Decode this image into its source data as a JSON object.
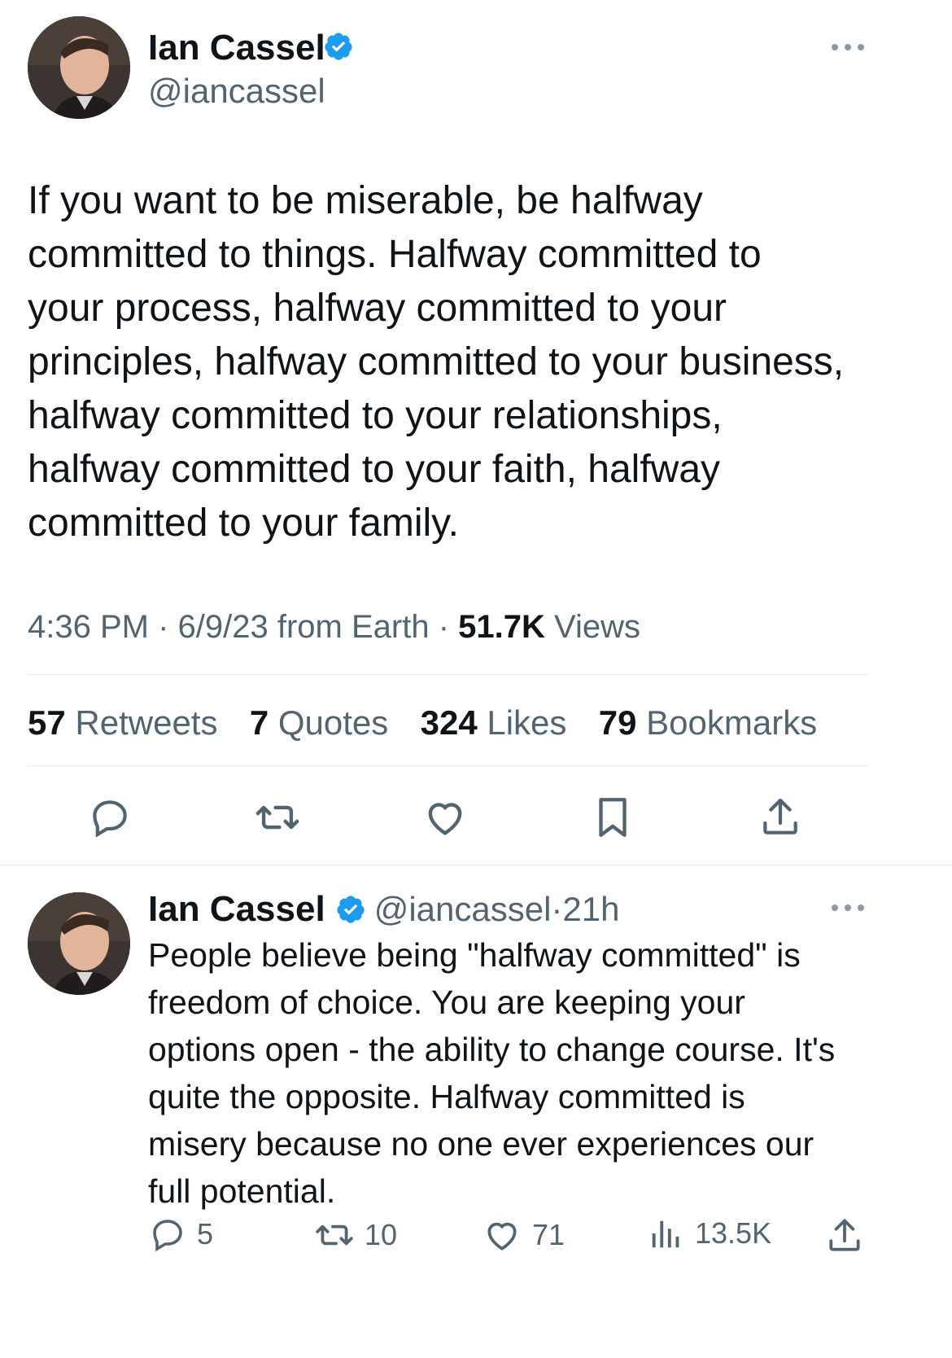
{
  "main_tweet": {
    "author_name": "Ian Cassel",
    "author_handle": "@iancassel",
    "more_icon": "more-icon",
    "text_lines": [
      "If you want to be miserable, be halfway",
      "committed to things. Halfway committed to",
      "your process, halfway committed to your",
      "principles, halfway committed to your business,",
      "halfway committed to your relationships,",
      "halfway committed to your faith, halfway",
      "committed to your family."
    ],
    "time": "4:36 PM",
    "date": "6/9/23 from Earth",
    "views_count": "51.7K",
    "views_label": "Views",
    "stats": {
      "retweets_count": "57",
      "retweets_label": "Retweets",
      "quotes_count": "7",
      "quotes_label": "Quotes",
      "likes_count": "324",
      "likes_label": "Likes",
      "bookmarks_count": "79",
      "bookmarks_label": "Bookmarks"
    },
    "actions": [
      "reply-icon",
      "retweet-icon",
      "like-icon",
      "bookmark-icon",
      "share-icon"
    ]
  },
  "reply_tweet": {
    "author_name": "Ian Cassel",
    "author_handle": "@iancassel",
    "age": "21h",
    "text_lines": [
      "People believe being \"halfway committed\" is",
      "freedom of choice. You are keeping your",
      "options open - the ability to change course. It's",
      "quite the opposite. Halfway committed is",
      "misery because no one ever experiences our",
      "full potential."
    ],
    "reply_count": "5",
    "retweet_count": "10",
    "like_count": "71",
    "views_count": "13.5K"
  },
  "colors": {
    "verified": "#1d9bf0",
    "text": "#0f1419",
    "secondary": "#536471",
    "divider": "#e6e9ec"
  }
}
